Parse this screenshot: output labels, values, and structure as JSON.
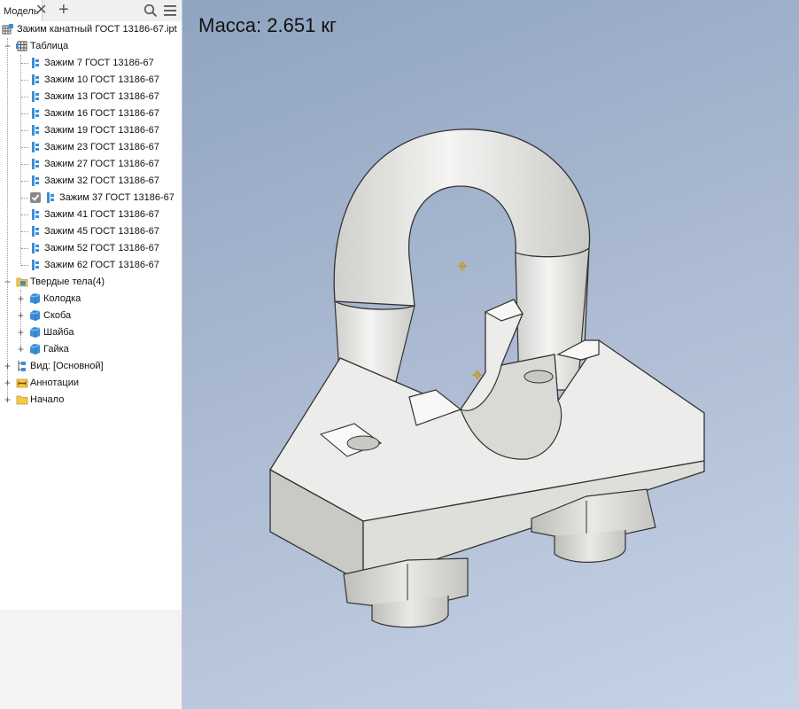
{
  "panel": {
    "tab_label": "Модель",
    "tab_close": "✕",
    "tab_add": "+",
    "root_label": "Зажим канатный ГОСТ 13186-67.ipt",
    "table_label": "Таблица",
    "table_rows": [
      "Зажим 7 ГОСТ 13186-67",
      "Зажим 10 ГОСТ 13186-67",
      "Зажим 13 ГОСТ 13186-67",
      "Зажим 16 ГОСТ 13186-67",
      "Зажим 19 ГОСТ 13186-67",
      "Зажим 23 ГОСТ 13186-67",
      "Зажим 27 ГОСТ 13186-67",
      "Зажим 32 ГОСТ 13186-67",
      "Зажим 37 ГОСТ 13186-67",
      "Зажим 41 ГОСТ 13186-67",
      "Зажим 45 ГОСТ 13186-67",
      "Зажим 52 ГОСТ 13186-67",
      "Зажим 62 ГОСТ 13186-67"
    ],
    "active_row": "Зажим 37 ГОСТ 13186-67",
    "solids_label": "Твердые тела(4)",
    "solids": [
      "Колодка",
      "Скоба",
      "Шайба",
      "Гайка"
    ],
    "view_label": "Вид: [Основной]",
    "annotations_label": "Аннотации",
    "origin_label": "Начало"
  },
  "icons": {
    "search": "search-icon",
    "menu": "hamburger-menu-icon",
    "part": "part-file-icon",
    "table": "table-icon",
    "member": "member-icon",
    "checkbox": "checkbox-icon",
    "folder": "folder-icon",
    "solid": "solid-body-icon",
    "view": "view-icon",
    "annotation": "annotation-icon"
  },
  "viewport": {
    "mass_text": "Масса: 2.651 кг"
  },
  "colors": {
    "viewport_top": "#8fa4c1",
    "viewport_bottom": "#c7d3e6",
    "model_face": "#ececea",
    "member_icon": "#3a8fd8",
    "folder": "#f2c94c"
  }
}
